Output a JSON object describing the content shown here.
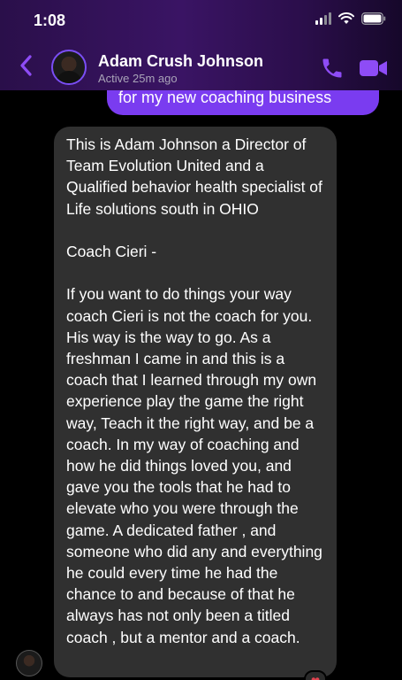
{
  "status_bar": {
    "time": "1:08",
    "signal_icon": "cellular-signal-icon",
    "wifi_icon": "wifi-icon",
    "battery_icon": "battery-icon"
  },
  "header": {
    "back_icon": "chevron-left-icon",
    "contact_name": "Adam Crush Johnson",
    "contact_status": "Active 25m ago",
    "call_icon": "phone-icon",
    "video_icon": "video-camera-icon",
    "accent_color": "#8e4cf6"
  },
  "messages": {
    "sent_tail": "for my new coaching business",
    "sent_color": "#7a3cf0",
    "received_color": "#303030",
    "received": {
      "intro": "This is Adam Johnson a Director of Team Evolution United and a Qualified behavior health specialist of Life solutions south in OHIO",
      "salutation": "Coach Cieri -",
      "body": "If you want to do things your way coach Cieri is not the coach for you. His way is the way to go. As a freshman I came in and this is a coach that I learned through my own experience play the game the right way, Teach it the right way, and be a coach. In my way of coaching and how he did things loved you, and gave you the tools that he had to elevate who you were through the game. A dedicated father , and someone who did any and everything he could every time he had the chance to and because of that he always has not only been a titled coach , but a mentor and a coach."
    },
    "reaction_icon": "heart-reaction-icon"
  }
}
